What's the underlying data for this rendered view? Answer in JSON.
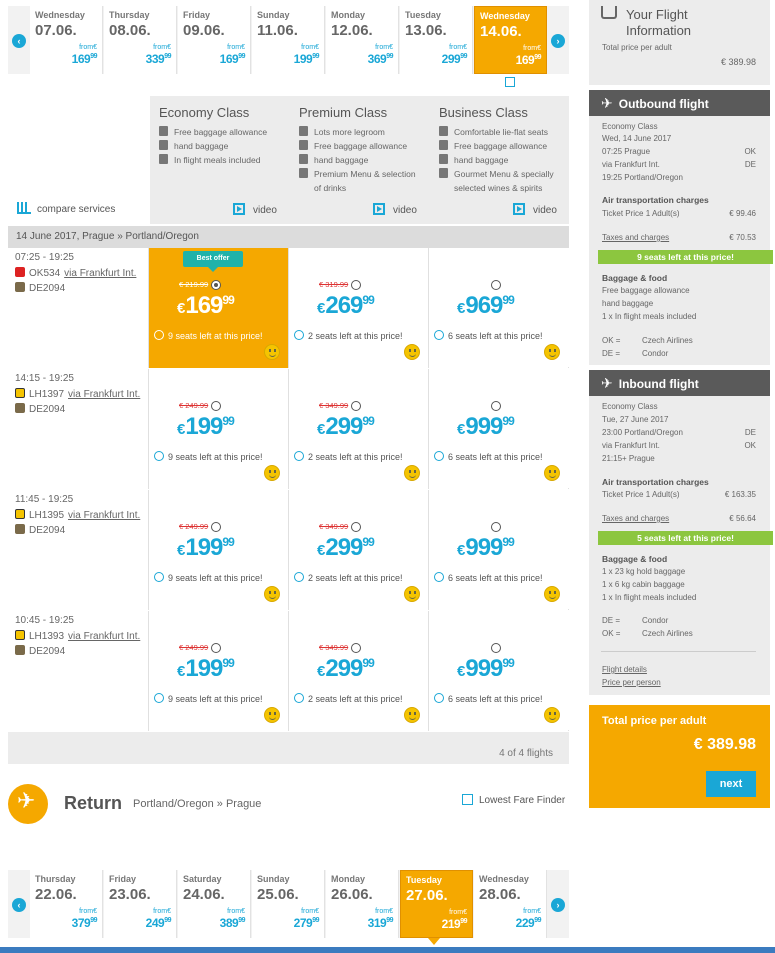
{
  "outbound_dates": {
    "items": [
      {
        "weekday": "Wednesday",
        "date": "07.06.",
        "from": "from€",
        "price": "169",
        "cents": "99"
      },
      {
        "weekday": "Thursday",
        "date": "08.06.",
        "from": "from€",
        "price": "339",
        "cents": "99"
      },
      {
        "weekday": "Friday",
        "date": "09.06.",
        "from": "from€",
        "price": "169",
        "cents": "99"
      },
      {
        "weekday": "Sunday",
        "date": "11.06.",
        "from": "from€",
        "price": "199",
        "cents": "99"
      },
      {
        "weekday": "Monday",
        "date": "12.06.",
        "from": "from€",
        "price": "369",
        "cents": "99"
      },
      {
        "weekday": "Tuesday",
        "date": "13.06.",
        "from": "from€",
        "price": "299",
        "cents": "99"
      },
      {
        "weekday": "Wednesday",
        "date": "14.06.",
        "from": "from€",
        "price": "169",
        "cents": "99"
      }
    ]
  },
  "classes": {
    "compare": "compare services",
    "video": "video",
    "cols": [
      {
        "name": "Economy Class",
        "features": [
          "Free baggage allowance",
          "hand baggage",
          "In flight meals included"
        ]
      },
      {
        "name": "Premium Class",
        "features": [
          "Lots more legroom",
          "Free baggage allowance",
          "hand baggage",
          "Premium Menu & selection",
          "of drinks"
        ]
      },
      {
        "name": "Business Class",
        "features": [
          "Comfortable lie-flat seats",
          "Free baggage allowance",
          "hand baggage",
          "Gourmet Menu & specially",
          "selected wines & spirits"
        ]
      }
    ]
  },
  "route_bar": "14 June 2017, Prague » Portland/Oregon",
  "best_offer": "Best offer",
  "flights": [
    {
      "time": "07:25 - 19:25",
      "f1": "OK534",
      "via": "via Frankfurt Int.",
      "f2": "DE2094",
      "prices": [
        {
          "old": "€ 219.99",
          "currency": "€",
          "main": "169",
          "cents": "99",
          "seats": "9 seats left at this price!"
        },
        {
          "old": "€ 319.99",
          "currency": "€",
          "main": "269",
          "cents": "99",
          "seats": "2 seats left at this price!"
        },
        {
          "old": "",
          "currency": "€",
          "main": "969",
          "cents": "99",
          "seats": "6 seats left at this price!"
        }
      ]
    },
    {
      "time": "14:15 - 19:25",
      "f1": "LH1397",
      "via": "via Frankfurt Int.",
      "f2": "DE2094",
      "prices": [
        {
          "old": "€ 249.99",
          "currency": "€",
          "main": "199",
          "cents": "99",
          "seats": "9 seats left at this price!"
        },
        {
          "old": "€ 349.99",
          "currency": "€",
          "main": "299",
          "cents": "99",
          "seats": "2 seats left at this price!"
        },
        {
          "old": "",
          "currency": "€",
          "main": "999",
          "cents": "99",
          "seats": "6 seats left at this price!"
        }
      ]
    },
    {
      "time": "11:45 - 19:25",
      "f1": "LH1395",
      "via": "via Frankfurt Int.",
      "f2": "DE2094",
      "prices": [
        {
          "old": "€ 249.99",
          "currency": "€",
          "main": "199",
          "cents": "99",
          "seats": "9 seats left at this price!"
        },
        {
          "old": "€ 349.99",
          "currency": "€",
          "main": "299",
          "cents": "99",
          "seats": "2 seats left at this price!"
        },
        {
          "old": "",
          "currency": "€",
          "main": "999",
          "cents": "99",
          "seats": "6 seats left at this price!"
        }
      ]
    },
    {
      "time": "10:45 - 19:25",
      "f1": "LH1393",
      "via": "via Frankfurt Int.",
      "f2": "DE2094",
      "prices": [
        {
          "old": "€ 249.99",
          "currency": "€",
          "main": "199",
          "cents": "99",
          "seats": "9 seats left at this price!"
        },
        {
          "old": "€ 349.99",
          "currency": "€",
          "main": "299",
          "cents": "99",
          "seats": "2 seats left at this price!"
        },
        {
          "old": "",
          "currency": "€",
          "main": "999",
          "cents": "99",
          "seats": "6 seats left at this price!"
        }
      ]
    }
  ],
  "counter": "4 of 4 flights",
  "return": {
    "title": "Return",
    "route": "Portland/Oregon » Prague",
    "lowest_fare": "Lowest Fare Finder"
  },
  "return_dates": {
    "items": [
      {
        "weekday": "Thursday",
        "date": "22.06.",
        "from": "from€",
        "price": "379",
        "cents": "99"
      },
      {
        "weekday": "Friday",
        "date": "23.06.",
        "from": "from€",
        "price": "249",
        "cents": "99"
      },
      {
        "weekday": "Saturday",
        "date": "24.06.",
        "from": "from€",
        "price": "389",
        "cents": "99"
      },
      {
        "weekday": "Sunday",
        "date": "25.06.",
        "from": "from€",
        "price": "279",
        "cents": "99"
      },
      {
        "weekday": "Monday",
        "date": "26.06.",
        "from": "from€",
        "price": "319",
        "cents": "99"
      },
      {
        "weekday": "Tuesday",
        "date": "27.06.",
        "from": "from€",
        "price": "219",
        "cents": "99"
      },
      {
        "weekday": "Wednesday",
        "date": "28.06.",
        "from": "from€",
        "price": "229",
        "cents": "99"
      }
    ]
  },
  "sidebar": {
    "title1": "Your Flight",
    "title2": "Information",
    "subtitle": "Total price per adult",
    "price": "€ 389.98",
    "outbound": {
      "heading": "Outbound flight",
      "cls": "Economy Class",
      "date": "Wed, 14 June 2017",
      "l1": "07:25 Prague",
      "l1r": "OK",
      "l2": "via Frankfurt Int.",
      "l2r": "DE",
      "l3": "19:25 Portland/Oregon",
      "charges_h": "Air transportation charges",
      "ticket": "Ticket Price 1 Adult(s)",
      "ticket_v": "€ 99.46",
      "taxes": "Taxes and charges",
      "taxes_v": "€ 70.53",
      "seats": "9 seats left at this price!",
      "bag_h": "Baggage & food",
      "bag1": "Free baggage allowance",
      "bag2": "hand baggage",
      "bag3": "1 x In flight meals included",
      "c1": "OK =",
      "c1v": "Czech Airlines",
      "c2": "DE =",
      "c2v": "Condor"
    },
    "inbound": {
      "heading": "Inbound flight",
      "cls": "Economy Class",
      "date": "Tue, 27 June 2017",
      "l1": "23:00 Portland/Oregon",
      "l1r": "DE",
      "l2": "via Frankfurt Int.",
      "l2r": "OK",
      "l3": "21:15+ Prague",
      "charges_h": "Air transportation charges",
      "ticket": "Ticket Price 1 Adult(s)",
      "ticket_v": "€ 163.35",
      "taxes": "Taxes and charges",
      "taxes_v": "€ 56.64",
      "seats": "5 seats left at this price!",
      "bag_h": "Baggage & food",
      "bag1": "1 x 23 kg hold baggage",
      "bag2": "1 x 6 kg cabin baggage",
      "bag3": "1 x In flight meals included",
      "c1": "DE =",
      "c1v": "Condor",
      "c2": "OK =",
      "c2v": "Czech Airlines"
    },
    "link1": "Flight details",
    "link2": "Price per person",
    "total_label": "Total price per adult",
    "total_amount": "€ 389.98",
    "next": "next"
  }
}
